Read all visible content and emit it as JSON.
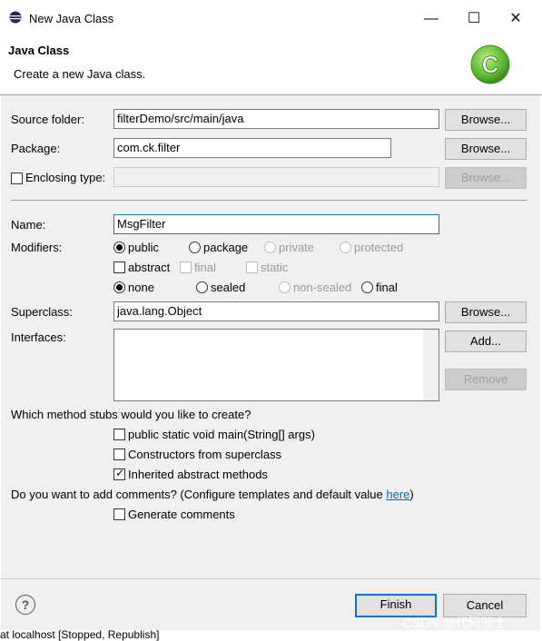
{
  "window": {
    "title": "New Java Class",
    "minimize_glyph": "—",
    "maximize_glyph": "☐",
    "close_glyph": "✕"
  },
  "header": {
    "title": "Java Class",
    "description": "Create a new Java class.",
    "logo_letter": "C"
  },
  "source_folder": {
    "label": "Source folder:",
    "value": "filterDemo/src/main/java",
    "browse": "Browse..."
  },
  "package": {
    "label": "Package:",
    "value": "com.ck.filter",
    "browse": "Browse..."
  },
  "enclosing": {
    "label": "Enclosing type:",
    "value": "",
    "browse": "Browse...",
    "checked": false
  },
  "name": {
    "label": "Name:",
    "value": "MsgFilter"
  },
  "modifiers": {
    "label": "Modifiers:",
    "access": [
      "public",
      "package",
      "private",
      "protected"
    ],
    "selected_access": "public",
    "flags": [
      "abstract",
      "final",
      "static"
    ],
    "sealed": [
      "none",
      "sealed",
      "non-sealed",
      "final"
    ],
    "selected_sealed": "none"
  },
  "superclass": {
    "label": "Superclass:",
    "value": "java.lang.Object",
    "browse": "Browse..."
  },
  "interfaces": {
    "label": "Interfaces:",
    "add": "Add...",
    "remove": "Remove"
  },
  "stubs": {
    "question": "Which method stubs would you like to create?",
    "items": [
      {
        "label": "public static void main(String[] args)",
        "checked": false
      },
      {
        "label": "Constructors from superclass",
        "checked": false
      },
      {
        "label": "Inherited abstract methods",
        "checked": true
      }
    ]
  },
  "comments": {
    "question_pre": "Do you want to add comments? (Configure templates and default value ",
    "link": "here",
    "question_post": ")",
    "generate": "Generate comments"
  },
  "footer": {
    "help": "?",
    "finish": "Finish",
    "cancel": "Cancel"
  },
  "watermark": "CSDN @代码骑士",
  "background_text": "at localhost  [Stopped, Republish]",
  "colors": {
    "accent": "#0078d7",
    "logo_green": "#5cb82e"
  }
}
